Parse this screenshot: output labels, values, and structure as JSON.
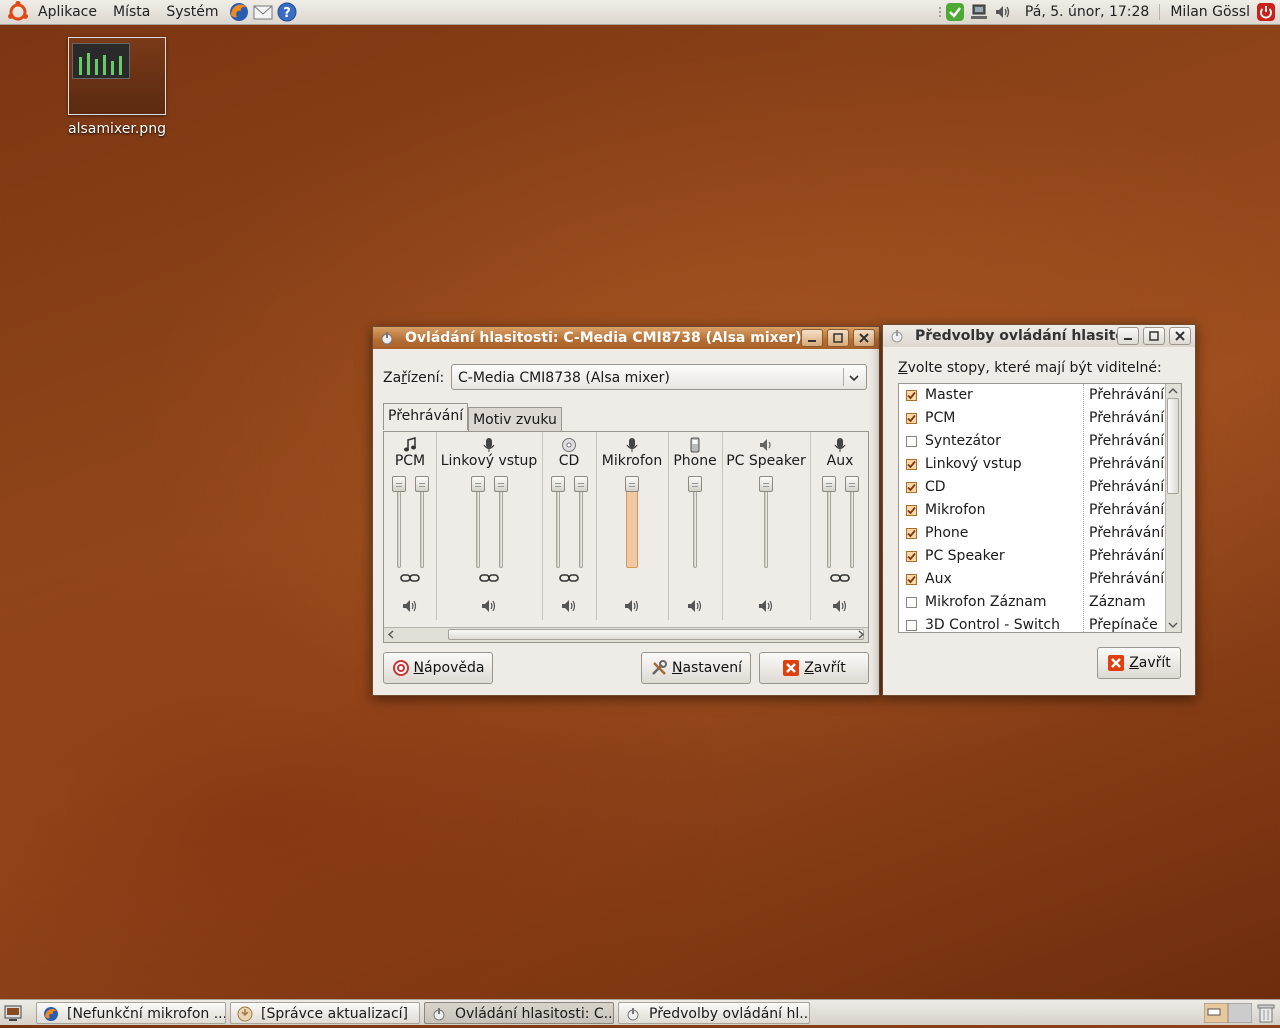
{
  "top_panel": {
    "menus": [
      "Aplikace",
      "Místa",
      "Systém"
    ],
    "clock": "Pá,  5. únor, 17:28",
    "user": "Milan Gössl"
  },
  "desktop": {
    "icon_label": "alsamixer.png"
  },
  "mixer_window": {
    "title": "Ovládání hlasitosti: C-Media CMI8738 (Alsa mixer)",
    "device_label_pre": "Za",
    "device_label_mn": "ř",
    "device_label_post": "ízení:",
    "device_value": "C-Media CMI8738 (Alsa mixer)",
    "tabs": [
      "Přehrávání",
      "Motiv zvuku"
    ],
    "channels": [
      {
        "name": "PCM",
        "icon": "music-note-icon",
        "stereo": true,
        "level": 1.0
      },
      {
        "name": "Linkový vstup",
        "icon": "microphone-icon",
        "stereo": true,
        "level": 1.0
      },
      {
        "name": "CD",
        "icon": "cd-icon",
        "stereo": true,
        "level": 1.0
      },
      {
        "name": "Mikrofon",
        "icon": "microphone-icon",
        "stereo": false,
        "level": 1.0
      },
      {
        "name": "Phone",
        "icon": "phone-icon",
        "stereo": false,
        "level": 1.0
      },
      {
        "name": "PC Speaker",
        "icon": "speaker-icon",
        "stereo": false,
        "level": 1.0
      },
      {
        "name": "Aux",
        "icon": "microphone-icon",
        "stereo": true,
        "level": 1.0
      }
    ],
    "help_button_mn": "N",
    "help_button_rest": "ápověda",
    "settings_button_mn": "N",
    "settings_button_rest": "astavení",
    "close_button_mn": "Z",
    "close_button_rest": "avřít"
  },
  "prefs_window": {
    "title": "Předvolby ovládání hlasitosti",
    "prompt_mn": "Z",
    "prompt_rest": "volte stopy, které mají být viditelné:",
    "tracks": [
      {
        "name": "Master",
        "type": "Přehrávání",
        "checked": true
      },
      {
        "name": "PCM",
        "type": "Přehrávání",
        "checked": true
      },
      {
        "name": "Syntezátor",
        "type": "Přehrávání",
        "checked": false
      },
      {
        "name": "Linkový vstup",
        "type": "Přehrávání",
        "checked": true
      },
      {
        "name": "CD",
        "type": "Přehrávání",
        "checked": true
      },
      {
        "name": "Mikrofon",
        "type": "Přehrávání",
        "checked": true
      },
      {
        "name": "Phone",
        "type": "Přehrávání",
        "checked": true
      },
      {
        "name": "PC Speaker",
        "type": "Přehrávání",
        "checked": true
      },
      {
        "name": "Aux",
        "type": "Přehrávání",
        "checked": true
      },
      {
        "name": "Mikrofon Záznam",
        "type": "Záznam",
        "checked": false
      },
      {
        "name": "3D Control - Switch",
        "type": "Přepínače",
        "checked": false
      }
    ],
    "close_button_mn": "Z",
    "close_button_rest": "avřít"
  },
  "taskbar": {
    "tasks": [
      {
        "label": "[Nefunkční mikrofon ...",
        "icon": "firefox-icon",
        "active": false
      },
      {
        "label": "[Správce aktualizací]",
        "icon": "update-manager-icon",
        "active": false
      },
      {
        "label": "Ovládání hlasitosti: C...",
        "icon": "volume-control-icon",
        "active": true
      },
      {
        "label": "Předvolby ovládání hl...",
        "icon": "volume-control-icon",
        "active": false
      }
    ]
  },
  "colors": {
    "accent": "#c07a3e",
    "desktop": "#8e4418",
    "window_bg": "#efebe7",
    "close_red": "#e04010"
  }
}
